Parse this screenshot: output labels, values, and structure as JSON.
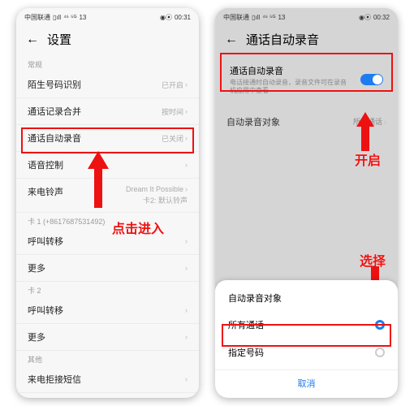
{
  "left": {
    "statusbar": {
      "carrier": "中国联通",
      "net": "⁴⁶ ⁵ᴳ",
      "time": "00:31",
      "battery": "13"
    },
    "header": {
      "title": "设置"
    },
    "sec_other": "常规",
    "rows": {
      "caller_id": {
        "label": "陌生号码识别",
        "value": "已开启"
      },
      "merge": {
        "label": "通话记录合并",
        "value": "按时间"
      },
      "auto_rec": {
        "label": "通话自动录音",
        "value": "已关闭"
      },
      "voice": {
        "label": "语音控制"
      },
      "ringtone": {
        "label": "来电铃声",
        "sub1": "Dream It Possible",
        "sub2": "卡2: 默认铃声"
      }
    },
    "sim1_label": "卡 1 (+8617687531492)",
    "sim1": {
      "forward": "呼叫转移",
      "more": "更多"
    },
    "sim2_label": "卡 2",
    "sim2": {
      "forward": "呼叫转移",
      "more": "更多"
    },
    "other_label": "其他",
    "other": {
      "block": "来电拒接短信"
    },
    "annotation": "点击进入"
  },
  "right": {
    "statusbar": {
      "carrier": "中国联通",
      "net": "⁴⁶ ⁵ᴳ",
      "time": "00:32",
      "battery": "13"
    },
    "header": {
      "title": "通话自动录音"
    },
    "auto": {
      "title": "通话自动录音",
      "desc": "电话接通时自动录音，录音文件可在录音机应用中查看"
    },
    "targets_row": {
      "label": "自动录音对象",
      "value": "所有通话"
    },
    "anno_open": "开启",
    "anno_select": "选择",
    "sheet": {
      "title": "自动录音对象",
      "opt1": "所有通话",
      "opt2": "指定号码",
      "cancel": "取消"
    }
  }
}
